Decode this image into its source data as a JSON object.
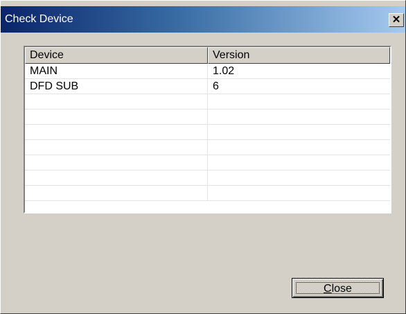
{
  "window": {
    "title": "Check Device",
    "close_glyph": "✕"
  },
  "list": {
    "columns": [
      "Device",
      "Version"
    ],
    "rows": [
      [
        "MAIN",
        "1.02"
      ],
      [
        "DFD SUB",
        "6"
      ],
      [
        "",
        ""
      ],
      [
        "",
        ""
      ],
      [
        "",
        ""
      ],
      [
        "",
        ""
      ],
      [
        "",
        ""
      ],
      [
        "",
        ""
      ],
      [
        "",
        ""
      ]
    ]
  },
  "buttons": {
    "close_accel": "C",
    "close_rest": "lose"
  },
  "colors": {
    "title_start": "#0a246a",
    "title_end": "#a6caf0",
    "face": "#d4d0c8"
  }
}
